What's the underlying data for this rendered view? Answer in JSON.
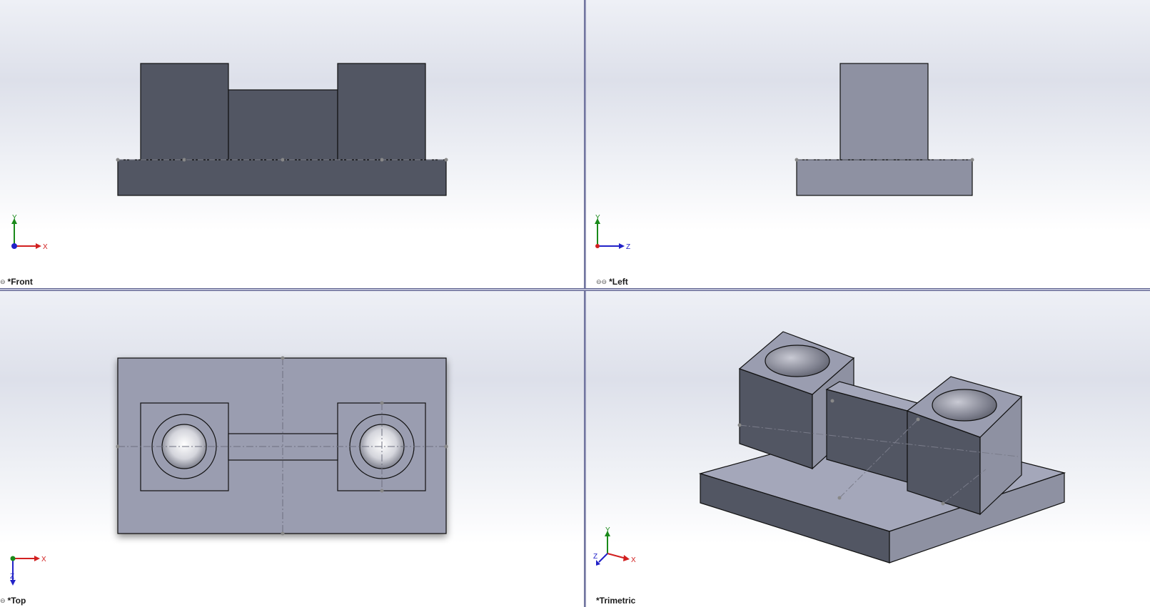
{
  "views": {
    "front": {
      "label": "*Front",
      "icon": "link-icon",
      "axes": [
        "Y",
        "X"
      ]
    },
    "left": {
      "label": "*Left",
      "icon": "link-icon",
      "axes": [
        "Y",
        "Z"
      ]
    },
    "top": {
      "label": "*Top",
      "icon": "link-icon",
      "axes": [
        "X",
        "Z"
      ]
    },
    "trimetric": {
      "label": "*Trimetric",
      "axes": [
        "Y",
        "X",
        "Z"
      ]
    }
  },
  "colors": {
    "dark_face": "#525663",
    "light_face": "#8e91a2",
    "top_face": "#9a9db0",
    "axis_x": "#d22020",
    "axis_y": "#1a8a1a",
    "axis_z": "#2222c8"
  }
}
